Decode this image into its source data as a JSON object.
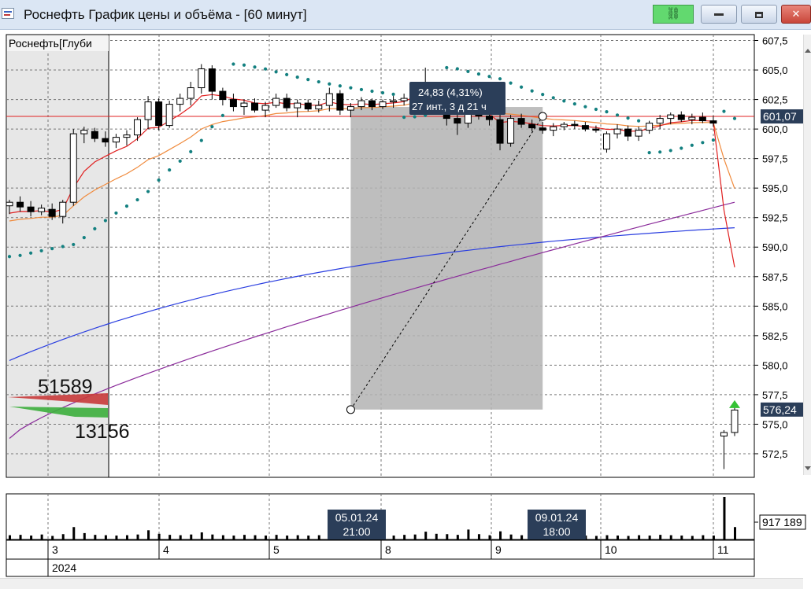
{
  "window": {
    "title": "Роснефть График цены и объёма - [60 минут]",
    "link_icon": "link-icon",
    "buttons": {
      "minimize": "minimize-icon",
      "maximize": "maximize-icon",
      "close": "✕"
    }
  },
  "colors": {
    "candle_up": "#ffffff",
    "candle_down": "#000000",
    "parabolic_sar": "#138080",
    "ma_fast": "#e02020",
    "ma_mid": "#f08a3c",
    "ma_slow_blue": "#2a3ee0",
    "ma_slow_purple": "#8a2a9a",
    "price_line": "#e02020",
    "selection": "#b3b3b3",
    "label_box": "#2b3e59"
  },
  "chart_data": [
    {
      "type": "candlestick",
      "title": "Роснефть[Глуби",
      "y_ticks": [
        "607,5",
        "605,0",
        "602,5",
        "600,0",
        "597,5",
        "595,0",
        "592,5",
        "590,0",
        "587,5",
        "585,0",
        "582,5",
        "580,0",
        "577,5",
        "575,0",
        "572,5"
      ],
      "ylim": [
        570.5,
        608
      ],
      "grid": true,
      "current_price_label": "601,07",
      "current_price": 601.07,
      "last_price_label": "576,24",
      "last_price": 576.24,
      "volume_profile": {
        "sell_label": "51589",
        "buy_label": "13156"
      },
      "measurement": {
        "line1": "24,83 (4,31%)",
        "line2": "27 инт., 3 д 21 ч",
        "start": {
          "bar": 32,
          "price": 576.24
        },
        "end": {
          "bar": 50,
          "price": 601.07
        }
      },
      "candles": [
        [
          593.5,
          594.0,
          592.8,
          593.8
        ],
        [
          593.8,
          594.3,
          593.0,
          593.4
        ],
        [
          593.4,
          593.9,
          592.6,
          593.0
        ],
        [
          593.0,
          593.6,
          592.7,
          593.3
        ],
        [
          593.2,
          593.7,
          592.3,
          592.6
        ],
        [
          592.6,
          594.0,
          592.0,
          593.8
        ],
        [
          593.8,
          600.0,
          593.5,
          599.6
        ],
        [
          599.6,
          600.2,
          598.8,
          599.9
        ],
        [
          599.8,
          600.1,
          598.9,
          599.2
        ],
        [
          599.2,
          599.8,
          598.5,
          598.9
        ],
        [
          598.9,
          599.6,
          598.4,
          599.3
        ],
        [
          599.3,
          599.9,
          598.6,
          599.5
        ],
        [
          599.5,
          601.0,
          599.0,
          600.8
        ],
        [
          600.8,
          602.8,
          600.0,
          602.3
        ],
        [
          602.3,
          602.6,
          599.9,
          600.3
        ],
        [
          600.3,
          602.4,
          600.1,
          602.1
        ],
        [
          602.1,
          603.0,
          601.5,
          602.6
        ],
        [
          602.6,
          604.0,
          602.0,
          603.5
        ],
        [
          603.5,
          605.5,
          603.0,
          605.1
        ],
        [
          605.1,
          605.4,
          602.5,
          603.2
        ],
        [
          603.2,
          603.5,
          602.0,
          602.5
        ],
        [
          602.5,
          603.0,
          601.5,
          601.9
        ],
        [
          601.9,
          602.5,
          601.2,
          602.2
        ],
        [
          602.2,
          602.6,
          601.4,
          601.6
        ],
        [
          601.6,
          602.3,
          601.0,
          602.0
        ],
        [
          602.0,
          603.0,
          601.8,
          602.6
        ],
        [
          602.6,
          603.0,
          601.5,
          601.8
        ],
        [
          601.8,
          602.5,
          601.0,
          602.2
        ],
        [
          602.2,
          602.5,
          601.5,
          601.7
        ],
        [
          601.7,
          602.4,
          601.4,
          602.0
        ],
        [
          602.0,
          603.5,
          601.5,
          603.0
        ],
        [
          603.0,
          603.3,
          601.2,
          601.6
        ],
        [
          601.6,
          602.2,
          601.0,
          601.9
        ],
        [
          601.9,
          602.7,
          601.6,
          602.4
        ],
        [
          602.4,
          602.6,
          601.6,
          601.9
        ],
        [
          601.9,
          602.5,
          601.7,
          602.3
        ],
        [
          602.3,
          602.8,
          601.8,
          602.4
        ],
        [
          602.4,
          603.0,
          602.0,
          602.6
        ],
        [
          602.6,
          604.0,
          602.3,
          603.8
        ],
        [
          603.8,
          605.2,
          602.5,
          602.9
        ],
        [
          602.9,
          603.6,
          601.5,
          601.8
        ],
        [
          601.8,
          602.5,
          600.3,
          600.9
        ],
        [
          600.9,
          601.5,
          599.5,
          600.5
        ],
        [
          600.5,
          602.0,
          600.1,
          601.5
        ],
        [
          601.5,
          602.3,
          600.8,
          601.1
        ],
        [
          601.1,
          601.6,
          600.3,
          600.8
        ],
        [
          600.8,
          601.8,
          598.2,
          598.8
        ],
        [
          598.8,
          601.2,
          598.5,
          600.9
        ],
        [
          600.9,
          601.3,
          600.1,
          600.4
        ],
        [
          600.4,
          600.8,
          599.8,
          600.1
        ],
        [
          600.1,
          600.6,
          599.6,
          599.9
        ],
        [
          599.9,
          600.5,
          599.4,
          600.2
        ],
        [
          600.2,
          600.6,
          599.9,
          600.4
        ],
        [
          600.4,
          600.7,
          600.0,
          600.3
        ],
        [
          600.3,
          600.6,
          599.8,
          600.0
        ],
        [
          600.0,
          600.3,
          599.7,
          599.9
        ],
        [
          598.3,
          599.8,
          598.0,
          599.6
        ],
        [
          599.6,
          600.4,
          599.2,
          600.0
        ],
        [
          600.0,
          600.3,
          599.0,
          599.4
        ],
        [
          599.4,
          600.2,
          599.0,
          599.9
        ],
        [
          599.9,
          600.7,
          599.6,
          600.5
        ],
        [
          600.5,
          601.2,
          600.0,
          600.9
        ],
        [
          600.9,
          601.4,
          600.4,
          601.2
        ],
        [
          601.2,
          601.5,
          600.6,
          600.8
        ],
        [
          600.8,
          601.3,
          600.4,
          601.0
        ],
        [
          601.0,
          601.4,
          600.5,
          600.7
        ],
        [
          600.7,
          601.1,
          600.2,
          600.5
        ],
        [
          574.0,
          574.5,
          571.2,
          574.3
        ],
        [
          574.3,
          576.5,
          574.0,
          576.2
        ]
      ],
      "volume": {
        "label": "917 189",
        "values": [
          1.2,
          1.3,
          1.1,
          1.4,
          1.0,
          1.5,
          3.5,
          1.8,
          1.3,
          1.2,
          1.1,
          1.2,
          1.4,
          2.6,
          1.6,
          1.3,
          1.2,
          1.4,
          2.0,
          1.4,
          1.2,
          1.1,
          1.3,
          1.2,
          1.1,
          1.3,
          1.1,
          1.2,
          1.1,
          1.2,
          1.5,
          1.3,
          1.1,
          1.2,
          1.1,
          1.2,
          1.1,
          1.3,
          1.4,
          2.2,
          1.6,
          1.5,
          1.3,
          2.8,
          1.5,
          1.2,
          2.3,
          1.4,
          1.2,
          1.1,
          1.2,
          1.1,
          1.0,
          1.2,
          1.1,
          1.0,
          1.2,
          1.1,
          1.0,
          1.2,
          1.1,
          1.3,
          1.2,
          1.1,
          1.0,
          1.2,
          1.1,
          12.0,
          3.5
        ]
      },
      "x_labels": {
        "days": [
          "3",
          "4",
          "5",
          "8",
          "9",
          "10",
          "11"
        ],
        "year": "2024",
        "cursor_labels": [
          {
            "line1": "05.01.24",
            "line2": "21:00"
          },
          {
            "line1": "09.01.24",
            "line2": "18:00"
          }
        ]
      }
    }
  ]
}
